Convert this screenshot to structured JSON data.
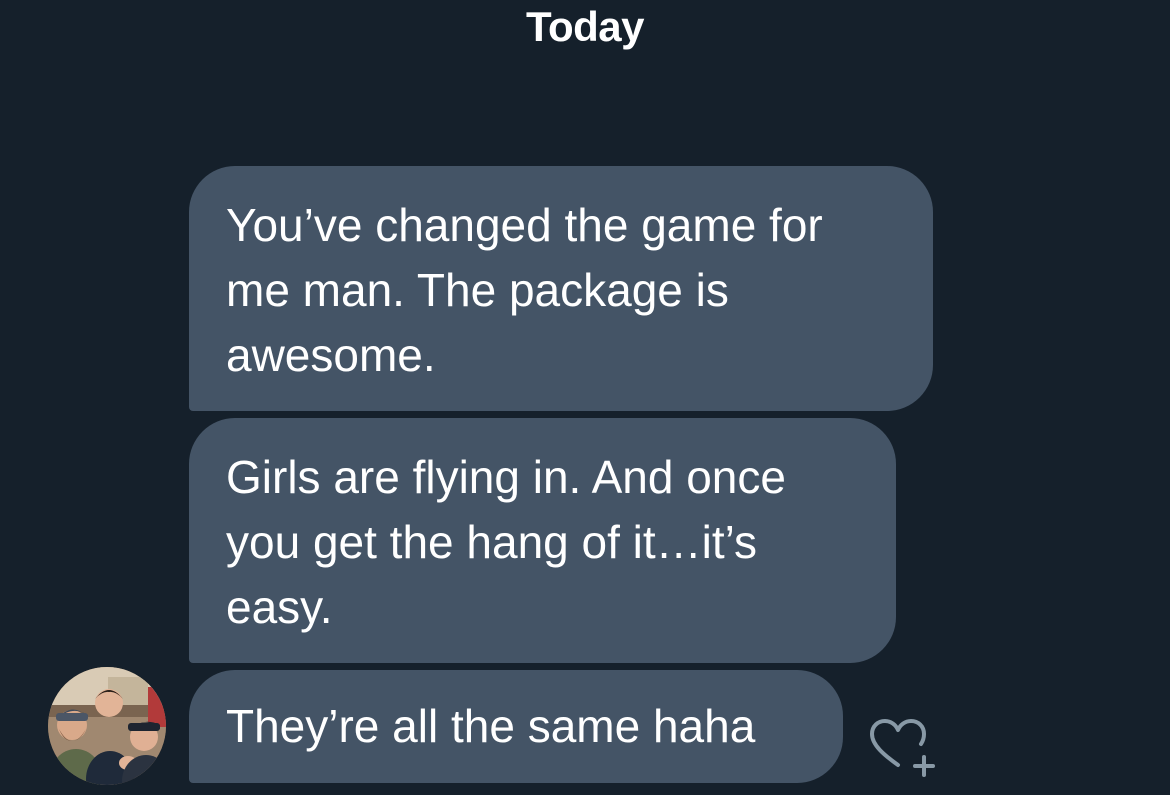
{
  "conversation": {
    "date_separator": "Today",
    "messages": [
      {
        "text": "You’ve changed the game for\nme man. The package is\nawesome."
      },
      {
        "text": "Girls are flying in. And once\nyou get the hang of it…it’s\neasy."
      },
      {
        "text": "They’re all the same haha"
      }
    ],
    "sender_avatar_icon": "avatar-photo",
    "reaction_icon": "heart-plus-icon"
  },
  "colors": {
    "background": "#15202b",
    "bubble": "#445466",
    "text": "#ffffff",
    "icon": "#8899a6"
  }
}
